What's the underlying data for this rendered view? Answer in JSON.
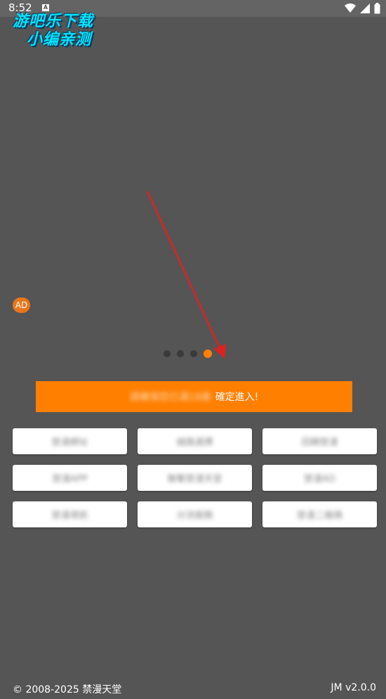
{
  "status_bar": {
    "time": "8:52",
    "notification_icon": "a-notification-icon",
    "icons": [
      "wifi-icon",
      "signal-icon",
      "battery-icon"
    ]
  },
  "watermark": {
    "line1": "游吧乐下载",
    "line2": "小编亲测"
  },
  "ad_badge": "AD",
  "carousel": {
    "count": 4,
    "active_index": 3
  },
  "enter_banner": {
    "blurred_text": "請確保您已滿18歲",
    "confirm_text": "確定進入!"
  },
  "buttons": [
    {
      "label": "禁漫網址"
    },
    {
      "label": "線路選擇"
    },
    {
      "label": "回歸禁漫"
    },
    {
      "label": "禁漫APP"
    },
    {
      "label": "聯繫禁漫天堂"
    },
    {
      "label": "禁漫AD"
    },
    {
      "label": "禁漫導航"
    },
    {
      "label": "分流服務"
    },
    {
      "label": "禁漫二維碼"
    }
  ],
  "footer": {
    "copyright": "© 2008-2025 禁漫天堂",
    "version": "JM v2.0.0"
  },
  "colors": {
    "background": "#555555",
    "accent": "#ff7f00",
    "annotation_arrow": "#e02020"
  }
}
